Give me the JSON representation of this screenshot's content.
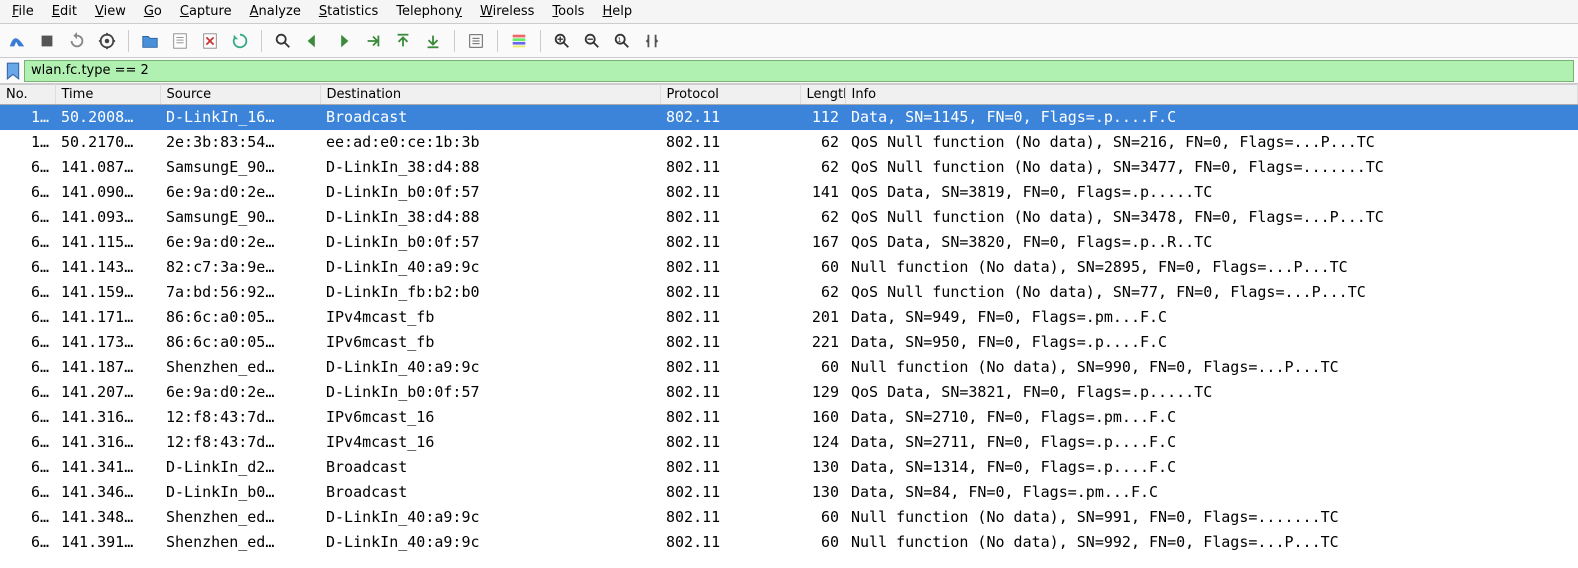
{
  "menu": {
    "items": [
      {
        "label": "File",
        "u": 0
      },
      {
        "label": "Edit",
        "u": 0
      },
      {
        "label": "View",
        "u": 0
      },
      {
        "label": "Go",
        "u": 0
      },
      {
        "label": "Capture",
        "u": 0
      },
      {
        "label": "Analyze",
        "u": 0
      },
      {
        "label": "Statistics",
        "u": 0
      },
      {
        "label": "Telephony",
        "u": 8
      },
      {
        "label": "Wireless",
        "u": 0
      },
      {
        "label": "Tools",
        "u": 0
      },
      {
        "label": "Help",
        "u": 0
      }
    ]
  },
  "toolbar": {
    "buttons": [
      "shark-fin-icon",
      "stop-icon",
      "restart-icon",
      "options-icon",
      "sep",
      "open-icon",
      "save-icon",
      "close-file-icon",
      "reload-icon",
      "sep",
      "find-icon",
      "go-back-icon",
      "go-forward-icon",
      "go-to-icon",
      "go-first-icon",
      "go-last-icon",
      "sep",
      "auto-scroll-icon",
      "sep",
      "colorize-icon",
      "sep",
      "zoom-in-icon",
      "zoom-out-icon",
      "zoom-reset-icon",
      "resize-columns-icon"
    ]
  },
  "filter": {
    "value": "wlan.fc.type == 2"
  },
  "columns": [
    "No.",
    "Time",
    "Source",
    "Destination",
    "Protocol",
    "Length",
    "Info"
  ],
  "packets": [
    {
      "no": "1…",
      "time": "50.2008…",
      "src": "D-LinkIn_16…",
      "dst": "Broadcast",
      "proto": "802.11",
      "len": "112",
      "info": "Data, SN=1145, FN=0, Flags=.p....F.C",
      "selected": true
    },
    {
      "no": "1…",
      "time": "50.2170…",
      "src": "2e:3b:83:54…",
      "dst": "ee:ad:e0:ce:1b:3b",
      "proto": "802.11",
      "len": "62",
      "info": "QoS Null function (No data), SN=216, FN=0, Flags=...P...TC"
    },
    {
      "no": "6…",
      "time": "141.087…",
      "src": "SamsungE_90…",
      "dst": "D-LinkIn_38:d4:88",
      "proto": "802.11",
      "len": "62",
      "info": "QoS Null function (No data), SN=3477, FN=0, Flags=.......TC"
    },
    {
      "no": "6…",
      "time": "141.090…",
      "src": "6e:9a:d0:2e…",
      "dst": "D-LinkIn_b0:0f:57",
      "proto": "802.11",
      "len": "141",
      "info": "QoS Data, SN=3819, FN=0, Flags=.p.....TC"
    },
    {
      "no": "6…",
      "time": "141.093…",
      "src": "SamsungE_90…",
      "dst": "D-LinkIn_38:d4:88",
      "proto": "802.11",
      "len": "62",
      "info": "QoS Null function (No data), SN=3478, FN=0, Flags=...P...TC"
    },
    {
      "no": "6…",
      "time": "141.115…",
      "src": "6e:9a:d0:2e…",
      "dst": "D-LinkIn_b0:0f:57",
      "proto": "802.11",
      "len": "167",
      "info": "QoS Data, SN=3820, FN=0, Flags=.p..R..TC"
    },
    {
      "no": "6…",
      "time": "141.143…",
      "src": "82:c7:3a:9e…",
      "dst": "D-LinkIn_40:a9:9c",
      "proto": "802.11",
      "len": "60",
      "info": "Null function (No data), SN=2895, FN=0, Flags=...P...TC"
    },
    {
      "no": "6…",
      "time": "141.159…",
      "src": "7a:bd:56:92…",
      "dst": "D-LinkIn_fb:b2:b0",
      "proto": "802.11",
      "len": "62",
      "info": "QoS Null function (No data), SN=77, FN=0, Flags=...P...TC"
    },
    {
      "no": "6…",
      "time": "141.171…",
      "src": "86:6c:a0:05…",
      "dst": "IPv4mcast_fb",
      "proto": "802.11",
      "len": "201",
      "info": "Data, SN=949, FN=0, Flags=.pm...F.C"
    },
    {
      "no": "6…",
      "time": "141.173…",
      "src": "86:6c:a0:05…",
      "dst": "IPv6mcast_fb",
      "proto": "802.11",
      "len": "221",
      "info": "Data, SN=950, FN=0, Flags=.p....F.C"
    },
    {
      "no": "6…",
      "time": "141.187…",
      "src": "Shenzhen_ed…",
      "dst": "D-LinkIn_40:a9:9c",
      "proto": "802.11",
      "len": "60",
      "info": "Null function (No data), SN=990, FN=0, Flags=...P...TC"
    },
    {
      "no": "6…",
      "time": "141.207…",
      "src": "6e:9a:d0:2e…",
      "dst": "D-LinkIn_b0:0f:57",
      "proto": "802.11",
      "len": "129",
      "info": "QoS Data, SN=3821, FN=0, Flags=.p.....TC"
    },
    {
      "no": "6…",
      "time": "141.316…",
      "src": "12:f8:43:7d…",
      "dst": "IPv6mcast_16",
      "proto": "802.11",
      "len": "160",
      "info": "Data, SN=2710, FN=0, Flags=.pm...F.C"
    },
    {
      "no": "6…",
      "time": "141.316…",
      "src": "12:f8:43:7d…",
      "dst": "IPv4mcast_16",
      "proto": "802.11",
      "len": "124",
      "info": "Data, SN=2711, FN=0, Flags=.p....F.C"
    },
    {
      "no": "6…",
      "time": "141.341…",
      "src": "D-LinkIn_d2…",
      "dst": "Broadcast",
      "proto": "802.11",
      "len": "130",
      "info": "Data, SN=1314, FN=0, Flags=.p....F.C"
    },
    {
      "no": "6…",
      "time": "141.346…",
      "src": "D-LinkIn_b0…",
      "dst": "Broadcast",
      "proto": "802.11",
      "len": "130",
      "info": "Data, SN=84, FN=0, Flags=.pm...F.C"
    },
    {
      "no": "6…",
      "time": "141.348…",
      "src": "Shenzhen_ed…",
      "dst": "D-LinkIn_40:a9:9c",
      "proto": "802.11",
      "len": "60",
      "info": "Null function (No data), SN=991, FN=0, Flags=.......TC"
    },
    {
      "no": "6…",
      "time": "141.391…",
      "src": "Shenzhen_ed…",
      "dst": "D-LinkIn_40:a9:9c",
      "proto": "802.11",
      "len": "60",
      "info": "Null function (No data), SN=992, FN=0, Flags=...P...TC"
    }
  ]
}
